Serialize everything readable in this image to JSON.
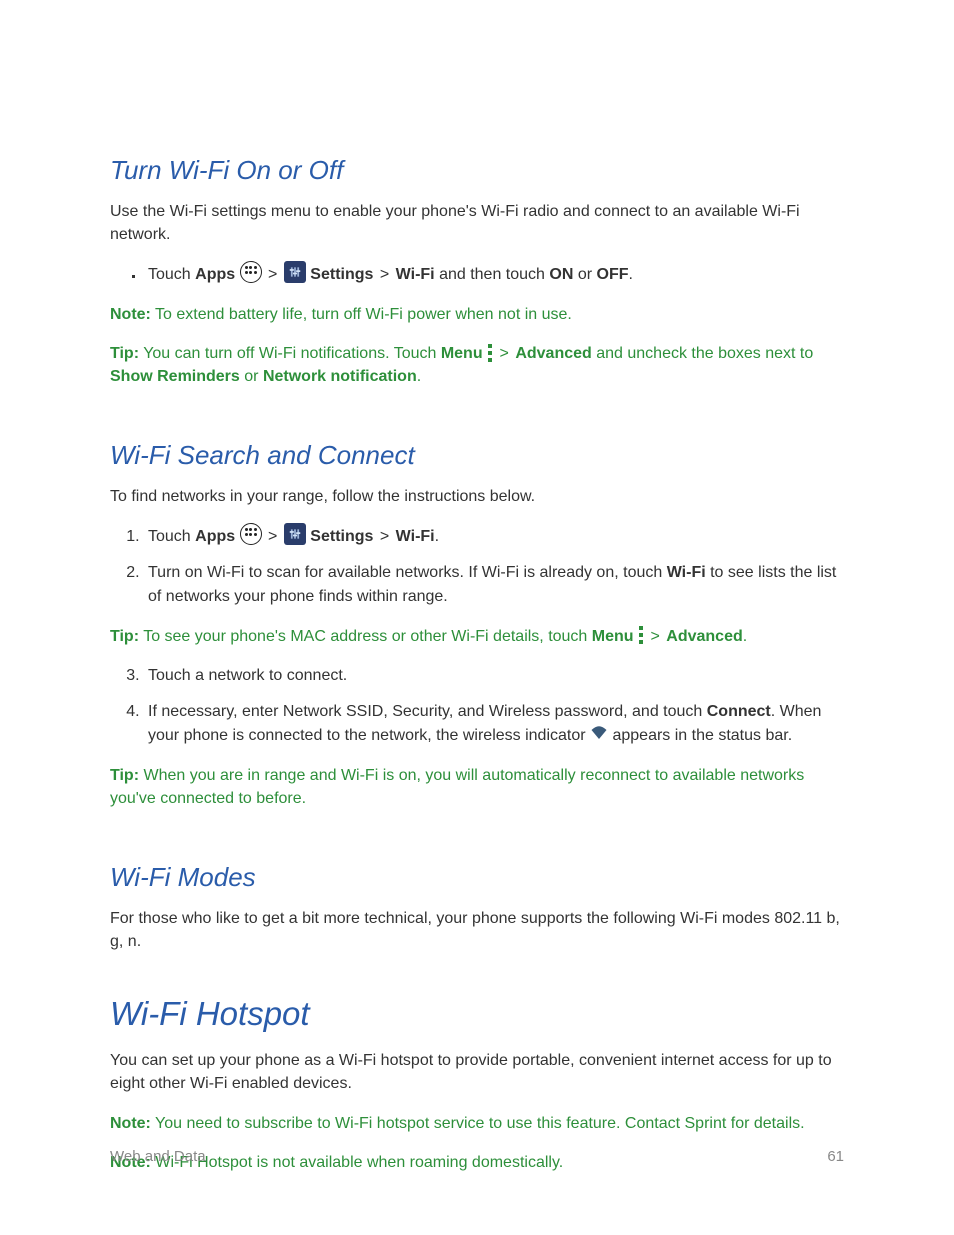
{
  "sections": {
    "turnWifi": {
      "heading": "Turn Wi-Fi On or Off",
      "intro": "Use the Wi-Fi settings menu to enable your phone's Wi-Fi radio and connect to an available Wi-Fi network.",
      "bullet1_pre": "Touch ",
      "bullet1_apps": "Apps",
      "bullet1_settings": " Settings",
      "bullet1_wifi": "Wi-Fi",
      "bullet1_mid": " and then touch ",
      "bullet1_on": "ON",
      "bullet1_or": " or ",
      "bullet1_off": "OFF",
      "bullet1_end": ".",
      "note1_label": "Note:",
      "note1_text": " To extend battery life, turn off Wi-Fi power when not in use.",
      "tip1_label": "Tip:",
      "tip1_a": " You can turn off Wi-Fi notifications. Touch ",
      "tip1_menu": "Menu",
      "tip1_adv": "Advanced",
      "tip1_b": " and uncheck the boxes next to ",
      "tip1_show": "Show Reminders",
      "tip1_or": " or ",
      "tip1_net": "Network notification",
      "tip1_end": "."
    },
    "searchConnect": {
      "heading": "Wi-Fi Search and Connect",
      "intro": "To find networks in your range, follow the instructions below.",
      "step1_pre": "Touch ",
      "step1_apps": "Apps",
      "step1_settings": " Settings",
      "step1_wifi": "Wi-Fi",
      "step1_end": ".",
      "step2_a": "Turn on Wi-Fi to scan for available networks. If Wi-Fi is already on, touch ",
      "step2_wifi": "Wi-Fi",
      "step2_b": " to see lists the list of networks your phone finds within range.",
      "tip2_label": "Tip:",
      "tip2_a": " To see your phone's MAC address or other Wi-Fi details, touch ",
      "tip2_menu": "Menu",
      "tip2_adv": "Advanced",
      "tip2_end": ".",
      "step3": "Touch a network to connect.",
      "step4_a": "If necessary, enter Network SSID, Security, and Wireless password, and touch ",
      "step4_connect": "Connect",
      "step4_b": ". When your phone is connected to the network, the wireless indicator ",
      "step4_c": " appears in the status bar.",
      "tip3_label": "Tip:",
      "tip3_text": " When you are in range and Wi-Fi is on, you will automatically reconnect to available networks you've connected to before."
    },
    "wifiModes": {
      "heading": "Wi-Fi Modes",
      "body": "For those who like to get a bit more technical, your phone supports the following Wi-Fi modes 802.11 b, g, n."
    },
    "hotspot": {
      "heading": "Wi-Fi Hotspot",
      "body": "You can set up your phone as a Wi-Fi hotspot to provide portable, convenient internet access for up to eight other Wi-Fi enabled devices.",
      "note1_label": "Note:",
      "note1_text": " You need to subscribe to Wi-Fi hotspot service to use this feature. Contact Sprint for details.",
      "note2_label": "Note:",
      "note2_text": " Wi-Fi Hotspot is not available when roaming domestically."
    }
  },
  "footer": {
    "left": "Web and Data",
    "right": "61"
  },
  "glyphs": {
    "gt": ">"
  }
}
